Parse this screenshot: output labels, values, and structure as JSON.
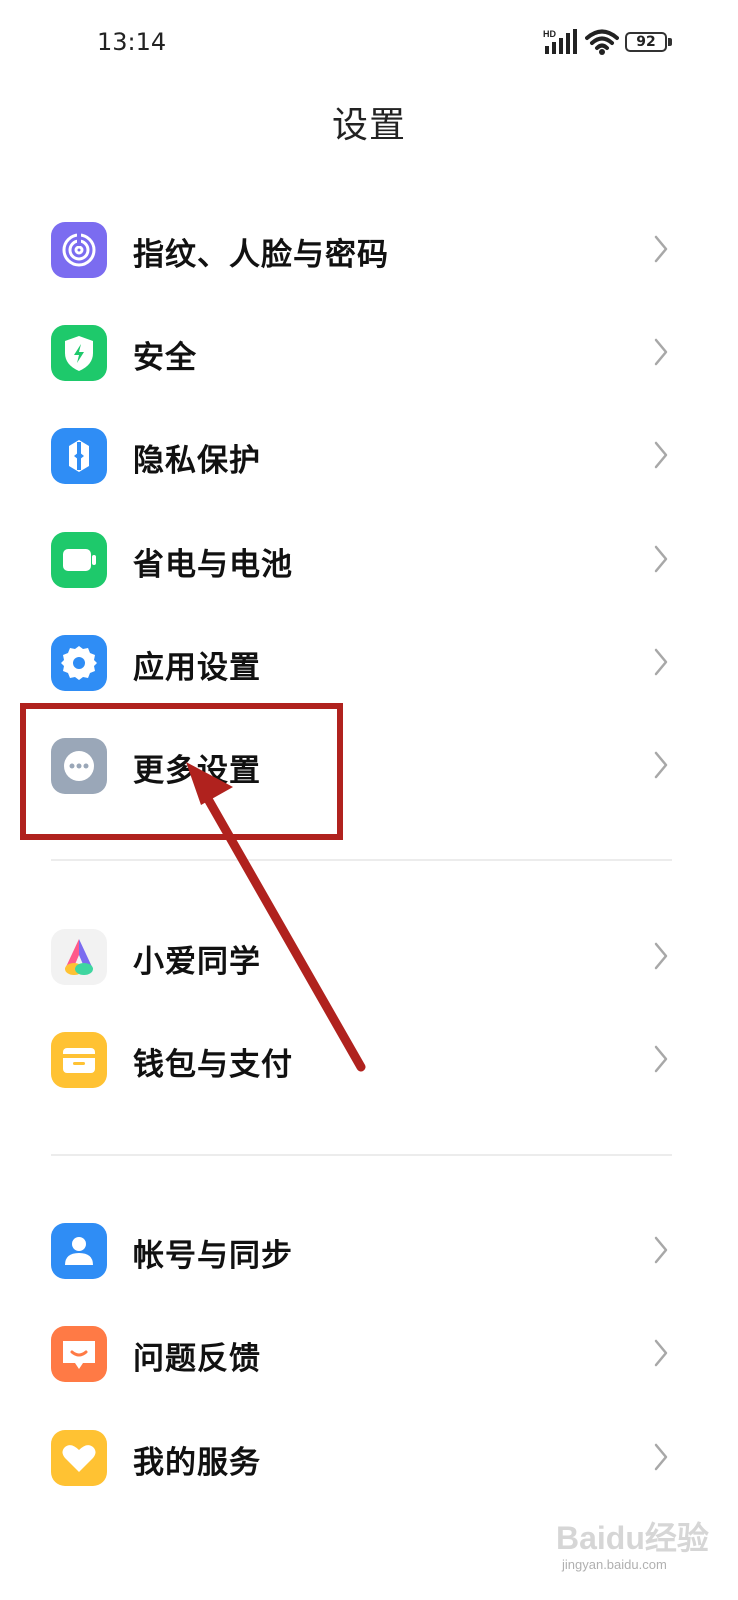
{
  "status_bar": {
    "time": "13:14",
    "network": "HD",
    "battery": "92"
  },
  "title": "设置",
  "groups": [
    {
      "items": [
        {
          "label": "指纹、人脸与密码",
          "icon": "fingerprint-icon",
          "color": "#7b6cf0"
        },
        {
          "label": "安全",
          "icon": "security-shield-icon",
          "color": "#1ec96b"
        },
        {
          "label": "隐私保护",
          "icon": "privacy-icon",
          "color": "#2f8df5"
        },
        {
          "label": "省电与电池",
          "icon": "battery-saver-icon",
          "color": "#1ec96b"
        },
        {
          "label": "应用设置",
          "icon": "app-settings-gear-icon",
          "color": "#2f8df5"
        },
        {
          "label": "更多设置",
          "icon": "more-settings-icon",
          "color": "#9aa7b8"
        }
      ]
    },
    {
      "items": [
        {
          "label": "小爱同学",
          "icon": "xiaoai-assistant-icon",
          "color": "#f2f2f2"
        },
        {
          "label": "钱包与支付",
          "icon": "wallet-icon",
          "color": "#ffc233"
        }
      ]
    },
    {
      "items": [
        {
          "label": "帐号与同步",
          "icon": "account-icon",
          "color": "#2f8df5"
        },
        {
          "label": "问题反馈",
          "icon": "feedback-icon",
          "color": "#ff7a45"
        },
        {
          "label": "我的服务",
          "icon": "my-services-icon",
          "color": "#ffc233"
        }
      ]
    }
  ],
  "annotation": {
    "highlight_color": "#b0221e",
    "target": "更多设置"
  },
  "watermark": {
    "text": "Baidu经验",
    "sub": "jingyan.baidu.com"
  }
}
